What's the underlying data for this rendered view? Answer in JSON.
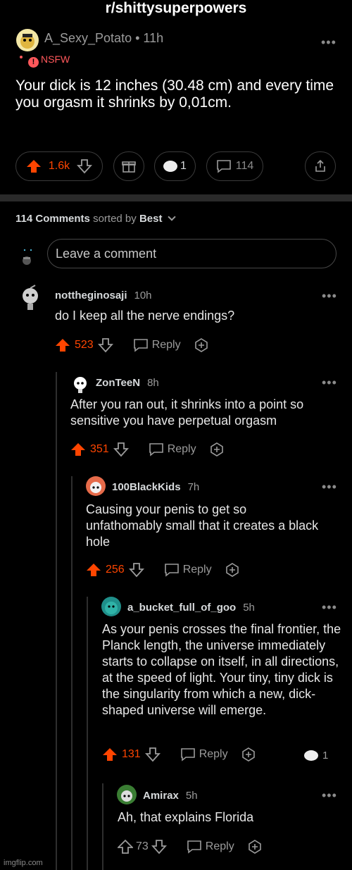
{
  "subreddit": "r/shittysuperpowers",
  "post": {
    "author": "A_Sexy_Potato",
    "age": "11h",
    "nsfw_label": "NSFW",
    "title": "Your dick is 12 inches (30.48 cm) and every time you orgasm it shrinks by 0,01cm.",
    "upvotes": "1.6k",
    "awards": "1",
    "comments": "114"
  },
  "comments_header": {
    "count_label": "114 Comments",
    "sorted_by": "sorted by",
    "sort": "Best"
  },
  "comment_input": {
    "placeholder": "Leave a comment"
  },
  "comments": [
    {
      "author": "nottheginosaji",
      "age": "10h",
      "text": "do I keep all the nerve endings?",
      "score": "523",
      "reply": "Reply"
    },
    {
      "author": "ZonTeeN",
      "age": "8h",
      "text": "After you ran out, it shrinks into a point so sensitive you have perpetual orgasm",
      "score": "351",
      "reply": "Reply"
    },
    {
      "author": "100BlackKids",
      "age": "7h",
      "text": "Causing your penis to get so unfathomably small that it creates a black hole",
      "score": "256",
      "reply": "Reply"
    },
    {
      "author": "a_bucket_full_of_goo",
      "age": "5h",
      "text": "As your penis crosses the final frontier, the Planck length, the universe immediately starts to collapse on itself, in all directions, at the speed of light. Your tiny, tiny dick is the singularity from which a new, dick-shaped universe will emerge.",
      "score": "131",
      "reply": "Reply",
      "awards": "1"
    },
    {
      "author": "Amirax",
      "age": "5h",
      "text": "Ah, that explains Florida",
      "score": "73",
      "reply": "Reply"
    }
  ],
  "watermark": "imgflip.com",
  "colors": {
    "upvote": "#ff4500",
    "nsfw": "#ff585b",
    "background": "#000000"
  }
}
